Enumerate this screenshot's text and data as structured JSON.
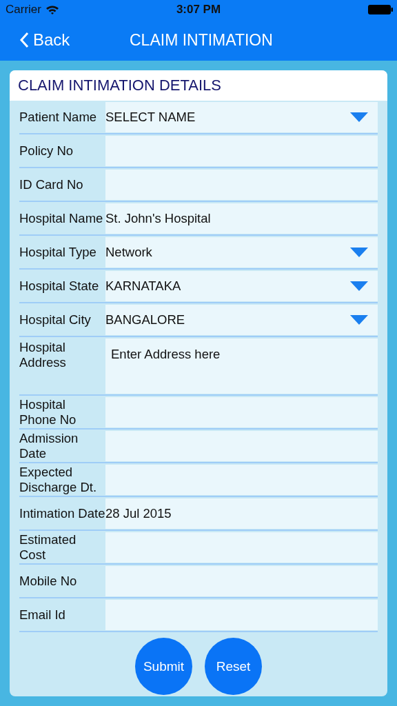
{
  "status_bar": {
    "carrier": "Carrier",
    "time": "3:07 PM"
  },
  "nav": {
    "back": "Back",
    "title": "CLAIM INTIMATION"
  },
  "form": {
    "heading": "CLAIM INTIMATION DETAILS",
    "fields": [
      {
        "kind": "dropdown",
        "label": "Patient Name",
        "value": "SELECT NAME"
      },
      {
        "kind": "text",
        "label": "Policy No"
      },
      {
        "kind": "text",
        "label": "ID Card No"
      },
      {
        "kind": "text",
        "label": "Hospital Name",
        "value": "St. John's Hospital"
      },
      {
        "kind": "dropdown",
        "label": "Hospital Type",
        "value": "Network"
      },
      {
        "kind": "dropdown",
        "label": "Hospital State",
        "value": "KARNATAKA"
      },
      {
        "kind": "dropdown",
        "label": "Hospital City",
        "value": "BANGALORE"
      },
      {
        "kind": "textarea",
        "label": "Hospital Address",
        "placeholder": "Enter Address here"
      },
      {
        "kind": "text",
        "label": "Hospital Phone No"
      },
      {
        "kind": "text",
        "label": "Admission Date"
      },
      {
        "kind": "text",
        "label": "Expected Discharge Dt."
      },
      {
        "kind": "text",
        "label": "Intimation Date",
        "value": "28 Jul 2015"
      },
      {
        "kind": "text",
        "label": "Estimated Cost"
      },
      {
        "kind": "text",
        "label": "Mobile No"
      },
      {
        "kind": "text",
        "label": "Email Id"
      }
    ],
    "buttons": [
      "Submit",
      "Reset"
    ]
  }
}
